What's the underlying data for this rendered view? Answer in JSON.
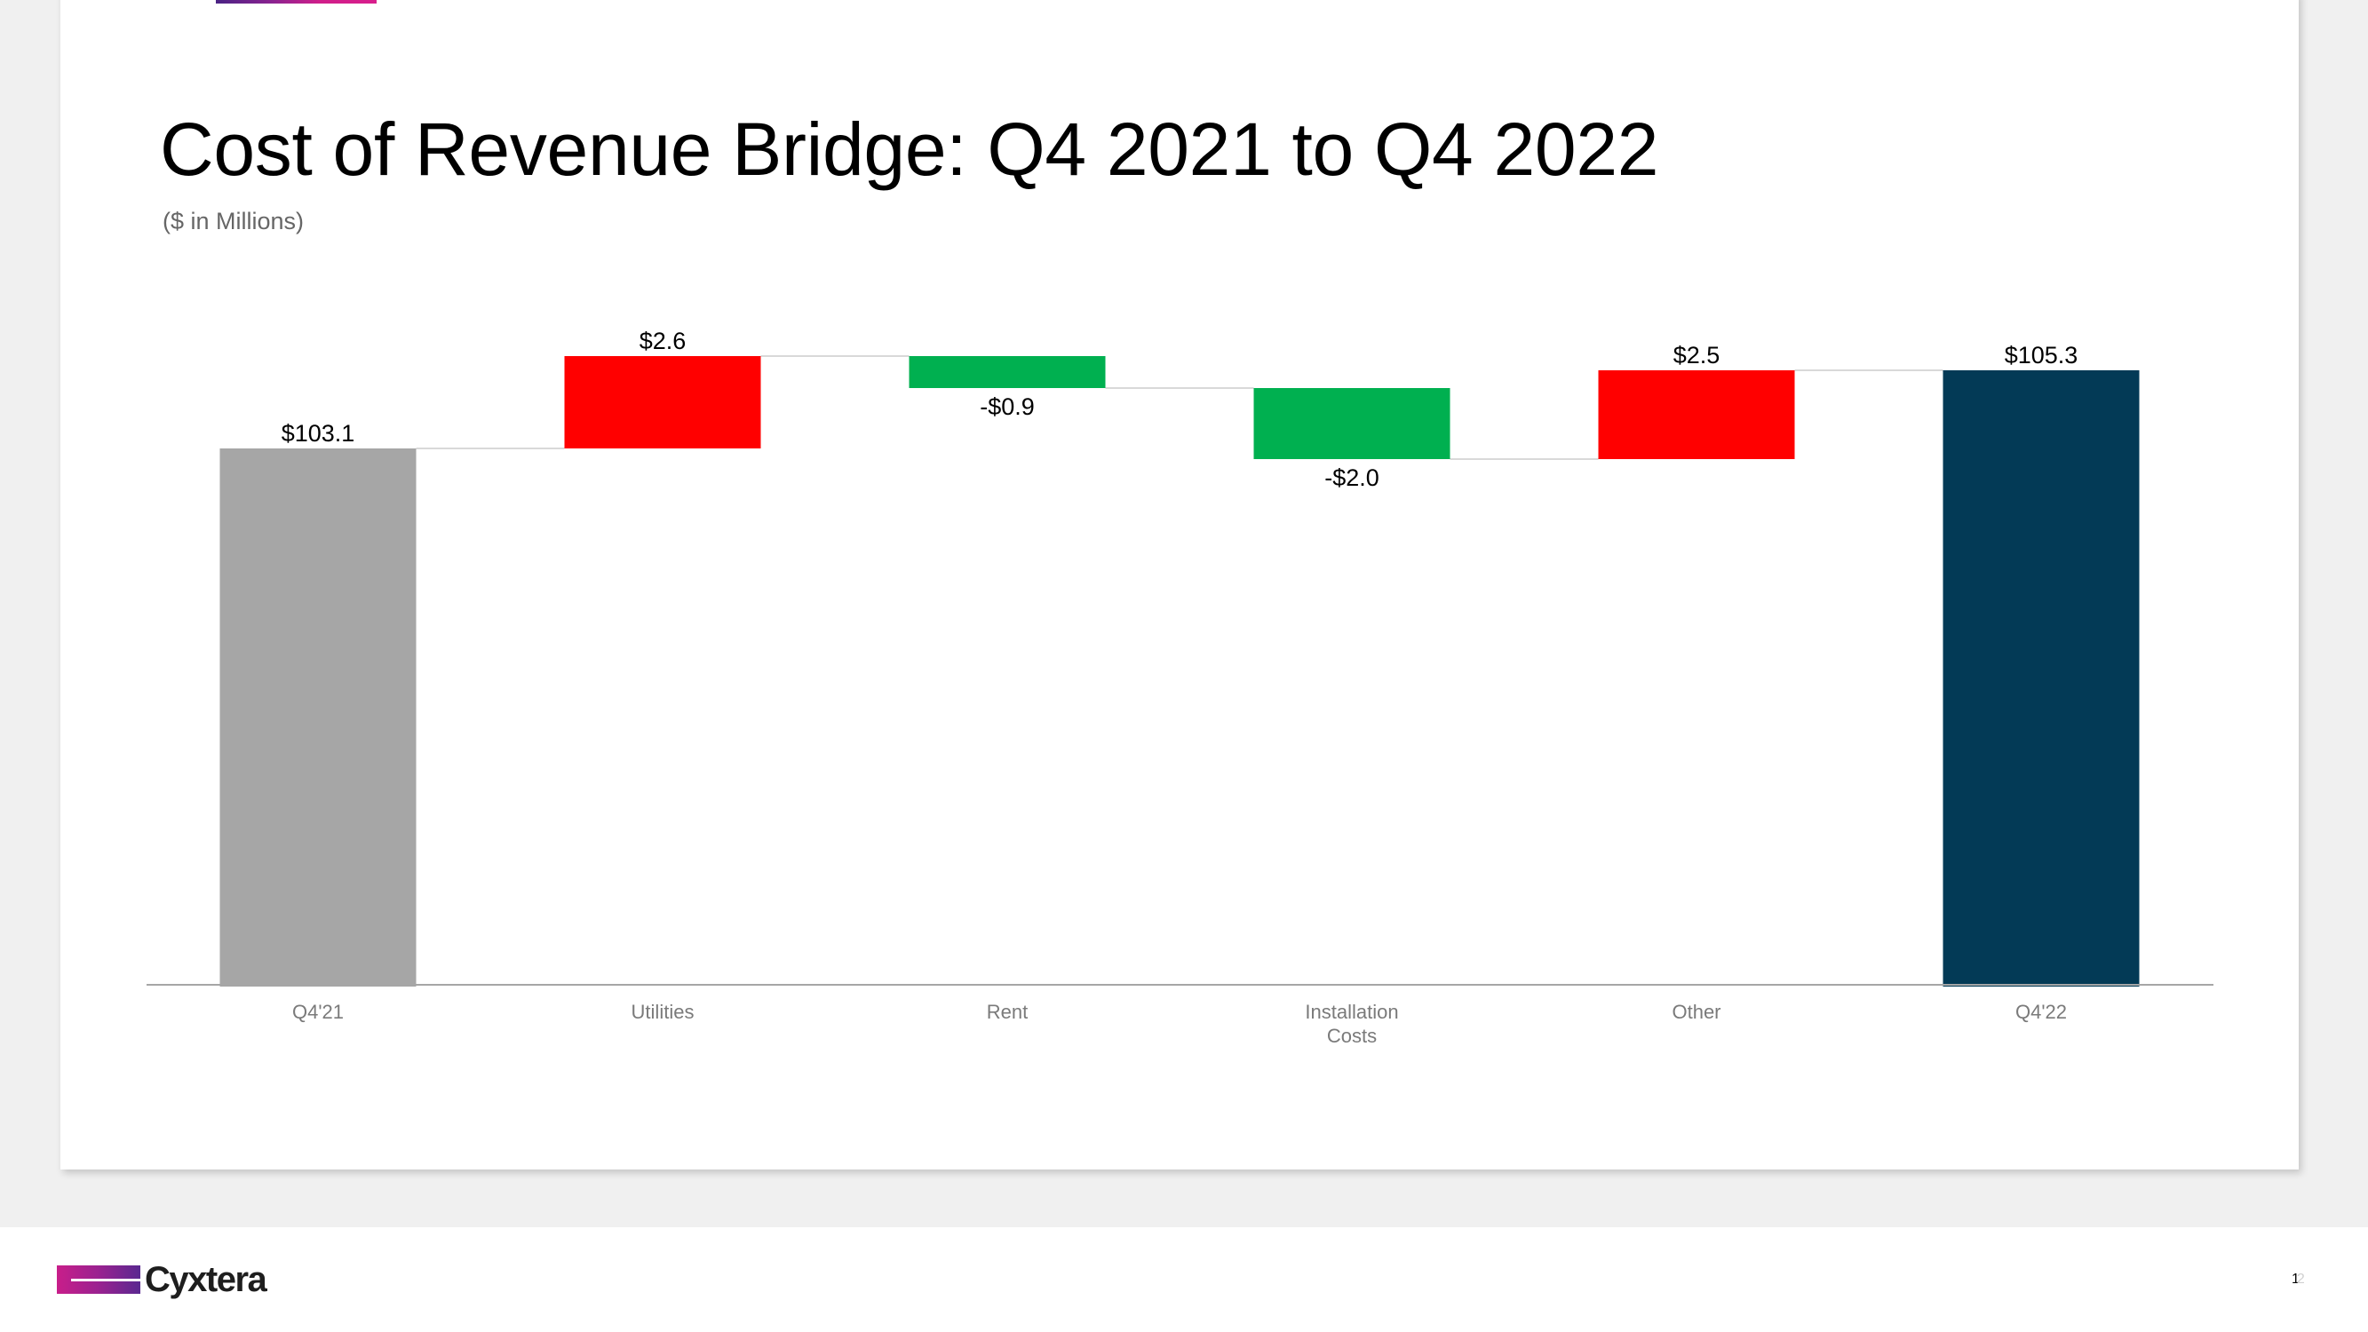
{
  "slide": {
    "title": "Cost of Revenue Bridge: Q4 2021 to Q4 2022",
    "subtitle": "($ in Millions)",
    "page_number": "1",
    "page_number_ghost": "2"
  },
  "footer": {
    "logo_text": "Cyxtera"
  },
  "colors": {
    "start_bar": "#a6a6a6",
    "increase": "#ff0000",
    "decrease": "#00b050",
    "end_bar": "#033a56",
    "connector": "#d9d9d9",
    "axis": "#a6a6a6",
    "accent_gradient_start": "#4a2384",
    "accent_gradient_end": "#d81e8c"
  },
  "chart_data": {
    "type": "bar",
    "subtype": "waterfall",
    "title": "Cost of Revenue Bridge: Q4 2021 to Q4 2022",
    "subtitle": "($ in Millions)",
    "xlabel": "",
    "ylabel": "",
    "ylim": [
      88,
      106
    ],
    "grid": false,
    "legend": "none",
    "categories": [
      "Q4'21",
      "Utilities",
      "Rent",
      "Installation Costs",
      "Other",
      "Q4'22"
    ],
    "category_lines": [
      [
        "Q4'21"
      ],
      [
        "Utilities"
      ],
      [
        "Rent"
      ],
      [
        "Installation",
        "Costs"
      ],
      [
        "Other"
      ],
      [
        "Q4'22"
      ]
    ],
    "values": [
      103.1,
      2.6,
      -0.9,
      -2.0,
      2.5,
      105.3
    ],
    "kinds": [
      "total",
      "delta",
      "delta",
      "delta",
      "delta",
      "total"
    ],
    "labels": [
      "$103.1",
      "$2.6",
      "-$0.9",
      "-$2.0",
      "$2.5",
      "$105.3"
    ]
  }
}
